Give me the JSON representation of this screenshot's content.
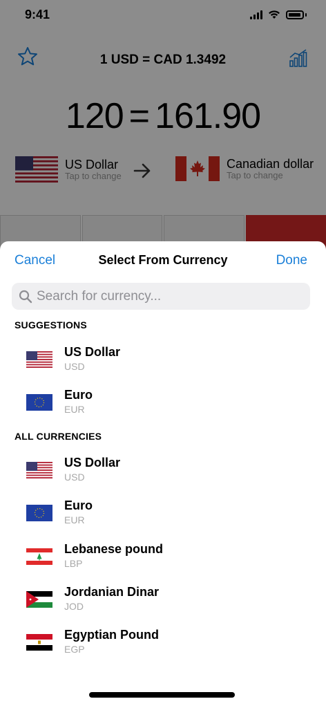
{
  "status": {
    "time": "9:41"
  },
  "background": {
    "rate": "1 USD = CAD 1.3492",
    "amount_from": "120",
    "equals": "=",
    "amount_to": "161.90",
    "from_currency": {
      "name": "US Dollar",
      "hint": "Tap to change"
    },
    "to_currency": {
      "name": "Canadian dollar",
      "hint": "Tap to change"
    }
  },
  "sheet": {
    "cancel_label": "Cancel",
    "title": "Select From Currency",
    "done_label": "Done",
    "search_placeholder": "Search for currency...",
    "suggestions_header": "SUGGESTIONS",
    "all_header": "ALL CURRENCIES",
    "suggestions": [
      {
        "name": "US Dollar",
        "code": "USD",
        "flag": "us-flag"
      },
      {
        "name": "Euro",
        "code": "EUR",
        "flag": "eu-flag"
      }
    ],
    "all": [
      {
        "name": "US Dollar",
        "code": "USD",
        "flag": "us-flag"
      },
      {
        "name": "Euro",
        "code": "EUR",
        "flag": "eu-flag"
      },
      {
        "name": "Lebanese pound",
        "code": "LBP",
        "flag": "lb-flag"
      },
      {
        "name": "Jordanian Dinar",
        "code": "JOD",
        "flag": "jo-flag"
      },
      {
        "name": "Egyptian Pound",
        "code": "EGP",
        "flag": "eg-flag"
      }
    ]
  },
  "colors": {
    "accent_blue": "#1a7fd8",
    "accent_red": "#d42a2a"
  }
}
